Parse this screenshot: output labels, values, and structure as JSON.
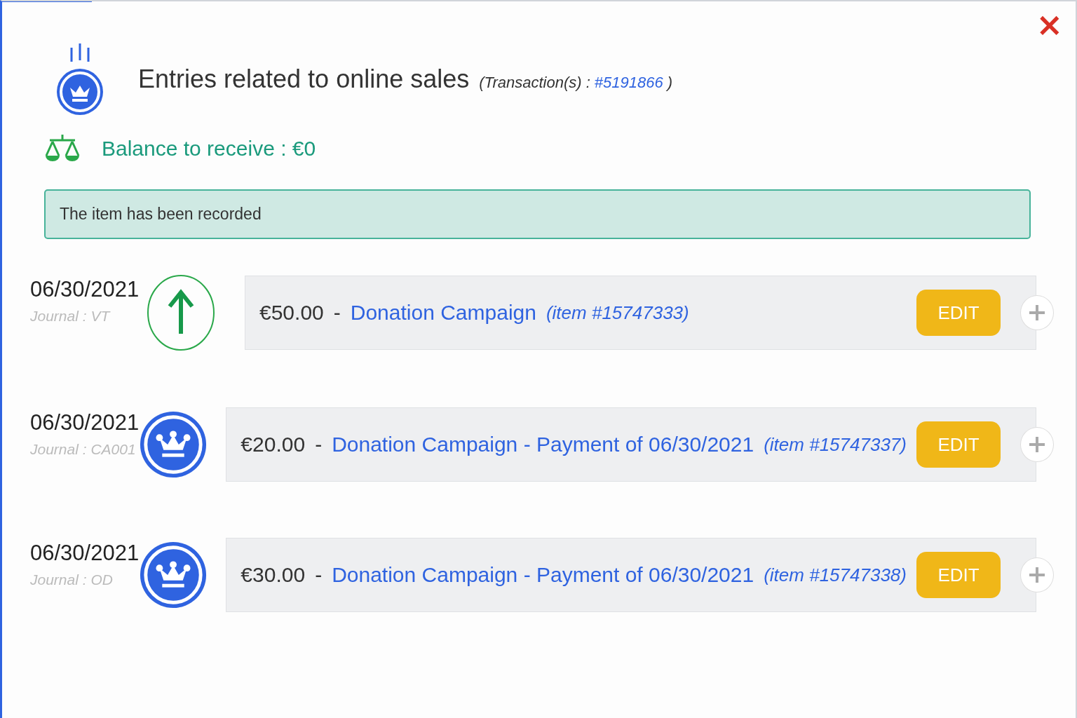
{
  "close_button": {
    "label": "×"
  },
  "header": {
    "title": "Entries related to online sales",
    "transaction_label": "(Transaction(s) :",
    "transaction_link": "#5191866",
    "transaction_close": ")"
  },
  "balance": {
    "text": "Balance to receive : €0"
  },
  "alert": {
    "text": "The item has been recorded"
  },
  "entries": [
    {
      "date": "06/30/2021",
      "journal": "Journal : VT",
      "kind": "sale",
      "amount": "€50.00",
      "separator": "-",
      "title": "Donation Campaign",
      "item": "(item #15747333)",
      "edit": "EDIT"
    },
    {
      "date": "06/30/2021",
      "journal": "Journal : CA001",
      "kind": "payment",
      "amount": "€20.00",
      "separator": "-",
      "title": "Donation Campaign - Payment of 06/30/2021",
      "item": "(item #15747337)",
      "edit": "EDIT"
    },
    {
      "date": "06/30/2021",
      "journal": "Journal : OD",
      "kind": "payment",
      "amount": "€30.00",
      "separator": "-",
      "title": "Donation Campaign - Payment of 06/30/2021",
      "item": "(item #15747338)",
      "edit": "EDIT"
    }
  ]
}
